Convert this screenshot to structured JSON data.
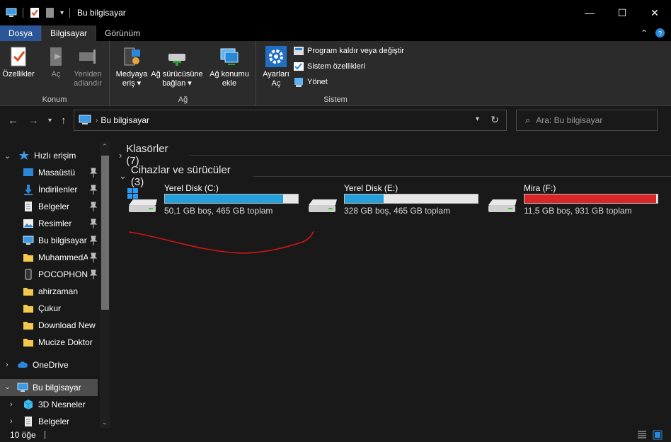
{
  "window": {
    "title": "Bu bilgisayar",
    "minimize_glyph": "—",
    "maximize_glyph": "☐",
    "close_glyph": "✕"
  },
  "menu_tabs": [
    "Dosya",
    "Bilgisayar",
    "Görünüm"
  ],
  "ribbon": {
    "konum": {
      "label": "Konum",
      "ozellikler": "Özellikler",
      "ac": "Aç",
      "yeniden_1": "Yeniden",
      "yeniden_2": "adlandır"
    },
    "ag": {
      "label": "Ağ",
      "medya_1": "Medyaya",
      "medya_2": "eriş",
      "surucu_1": "Ağ sürücüsüne",
      "surucu_2": "bağlan",
      "konum_1": "Ağ konumu",
      "konum_2": "ekle"
    },
    "sistem": {
      "label": "Sistem",
      "ayarlar_1": "Ayarları",
      "ayarlar_2": "Aç",
      "program": "Program kaldır veya değiştir",
      "sistem_ozellikleri": "Sistem özellikleri",
      "yonet": "Yönet"
    }
  },
  "address": {
    "path": "Bu bilgisayar",
    "search_placeholder": "Ara: Bu bilgisayar"
  },
  "nav": {
    "quick_access": "Hızlı erişim",
    "items": [
      "Masaüstü",
      "İndirilenler",
      "Belgeler",
      "Resimler",
      "Bu bilgisayar",
      "MuhammedA",
      "POCOPHONE",
      "ahirzaman",
      "Çukur",
      "Download New",
      "Mucize Doktor"
    ],
    "onedrive": "OneDrive",
    "this_pc": "Bu bilgisayar",
    "sub": [
      "3D Nesneler",
      "Belgeler"
    ]
  },
  "content": {
    "folders_header": "Klasörler (7)",
    "devices_header": "Cihazlar ve sürücüler (3)",
    "drives": [
      {
        "name": "Yerel Disk (C:)",
        "info": "50,1 GB boş, 465 GB toplam",
        "used_fraction": 0.89,
        "bar_color": "#26a0da",
        "windows_logo": true
      },
      {
        "name": "Yerel Disk (E:)",
        "info": "328 GB boş, 465 GB toplam",
        "used_fraction": 0.29,
        "bar_color": "#26a0da",
        "windows_logo": false
      },
      {
        "name": "Mira (F:)",
        "info": "11,5 GB boş, 931 GB toplam",
        "used_fraction": 0.99,
        "bar_color": "#da2626",
        "windows_logo": false
      }
    ]
  },
  "status": {
    "count": "10 öğe"
  },
  "colors": {
    "accent": "#2b579a",
    "annotation_stroke": "#d01515"
  }
}
